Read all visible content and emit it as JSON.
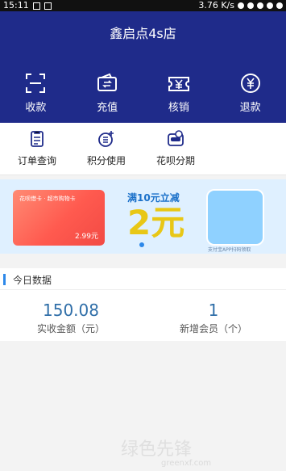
{
  "status": {
    "time": "15:11",
    "speed": "3.76 K/s"
  },
  "header": {
    "title": "鑫启点4s店"
  },
  "actions": [
    {
      "label": "收款",
      "icon": "scan-icon"
    },
    {
      "label": "充值",
      "icon": "wallet-icon"
    },
    {
      "label": "核销",
      "icon": "ticket-icon"
    },
    {
      "label": "退款",
      "icon": "refund-icon"
    }
  ],
  "quick": [
    {
      "label": "订单查询",
      "icon": "order-icon"
    },
    {
      "label": "积分使用",
      "icon": "points-icon"
    },
    {
      "label": "花呗分期",
      "icon": "installment-icon"
    }
  ],
  "banner": {
    "card_brand": "花呗借卡 · 超市购物卡",
    "card_price": "2.99元",
    "line1": "满10元立减",
    "big": "2元",
    "note": "支付宝APP扫码领取"
  },
  "today": {
    "title": "今日数据",
    "amount_value": "150.08",
    "amount_label": "实收金额（元）",
    "members_value": "1",
    "members_label": "新增会员（个）"
  },
  "watermark": {
    "text": "绿色先锋",
    "sub": "greenxf.com"
  },
  "colors": {
    "header_bg": "#1f2b8a",
    "accent": "#2d88e9"
  }
}
